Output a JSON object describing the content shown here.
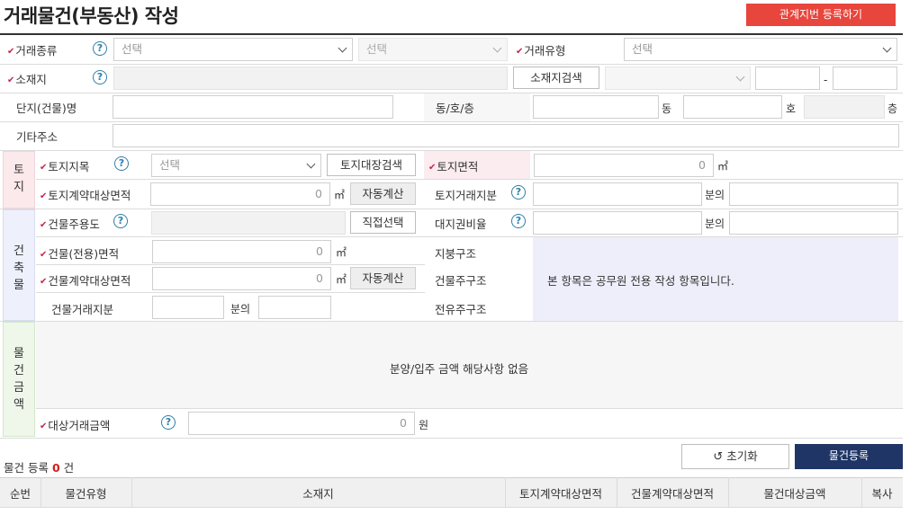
{
  "header": {
    "title": "거래물건(부동산) 작성",
    "register_button": "관계지번 등록하기"
  },
  "form": {
    "trade_type": {
      "label": "거래종류",
      "select1": "선택",
      "select2": "선택"
    },
    "trade_category": {
      "label": "거래유형",
      "select": "선택"
    },
    "location": {
      "label": "소재지",
      "search_button": "소재지검색",
      "dash": "-"
    },
    "complex_name": {
      "label": "단지(건물)명"
    },
    "dong_ho_floor": {
      "label": "동/호/층",
      "dong": "동",
      "ho": "호",
      "floor": "층"
    },
    "other_address": {
      "label": "기타주소"
    }
  },
  "land": {
    "section_label": "토\n지",
    "land_category": {
      "label": "토지지목",
      "select": "선택",
      "button": "토지대장검색"
    },
    "land_area": {
      "label": "토지면적",
      "value": "0",
      "unit": "㎡"
    },
    "contract_area": {
      "label": "토지계약대상면적",
      "value": "0",
      "unit": "㎡",
      "button": "자동계산"
    },
    "share": {
      "label": "토지거래지분",
      "unit": "분의"
    }
  },
  "building": {
    "section_label": "건\n축\n물",
    "usage": {
      "label": "건물주용도",
      "button": "직접선택"
    },
    "land_right_ratio": {
      "label": "대지권비율",
      "unit": "분의"
    },
    "exclusive_area": {
      "label": "건물(전용)면적",
      "value": "0",
      "unit": "㎡"
    },
    "contract_area": {
      "label": "건물계약대상면적",
      "value": "0",
      "unit": "㎡",
      "button": "자동계산"
    },
    "share": {
      "label": "건물거래지분",
      "unit": "분의"
    },
    "roof_structure": "지붕구조",
    "main_structure": "건물주구조",
    "exclusive_structure": "전유주구조",
    "official_notice": "본 항목은 공무원 전용 작성 항목입니다."
  },
  "amount": {
    "section_label": "물\n건\n금\n액",
    "sale_notice": "분양/입주 금액 해당사항 없음",
    "target_amount": {
      "label": "대상거래금액",
      "value": "0",
      "unit": "원"
    }
  },
  "footer": {
    "count_label": "물건 등록",
    "count_value": "0",
    "count_unit": "건",
    "reset_button": "초기화",
    "register_button": "물건등록"
  },
  "table": {
    "headers": [
      "순번",
      "물건유형",
      "소재지",
      "토지계약대상면적",
      "건물계약대상면적",
      "물건대상금액",
      "복사"
    ]
  },
  "colors": {
    "accent_red": "#e8453c",
    "navy": "#1f3566",
    "required_mark": "#c8254a",
    "help_icon": "#2f7fa8"
  }
}
